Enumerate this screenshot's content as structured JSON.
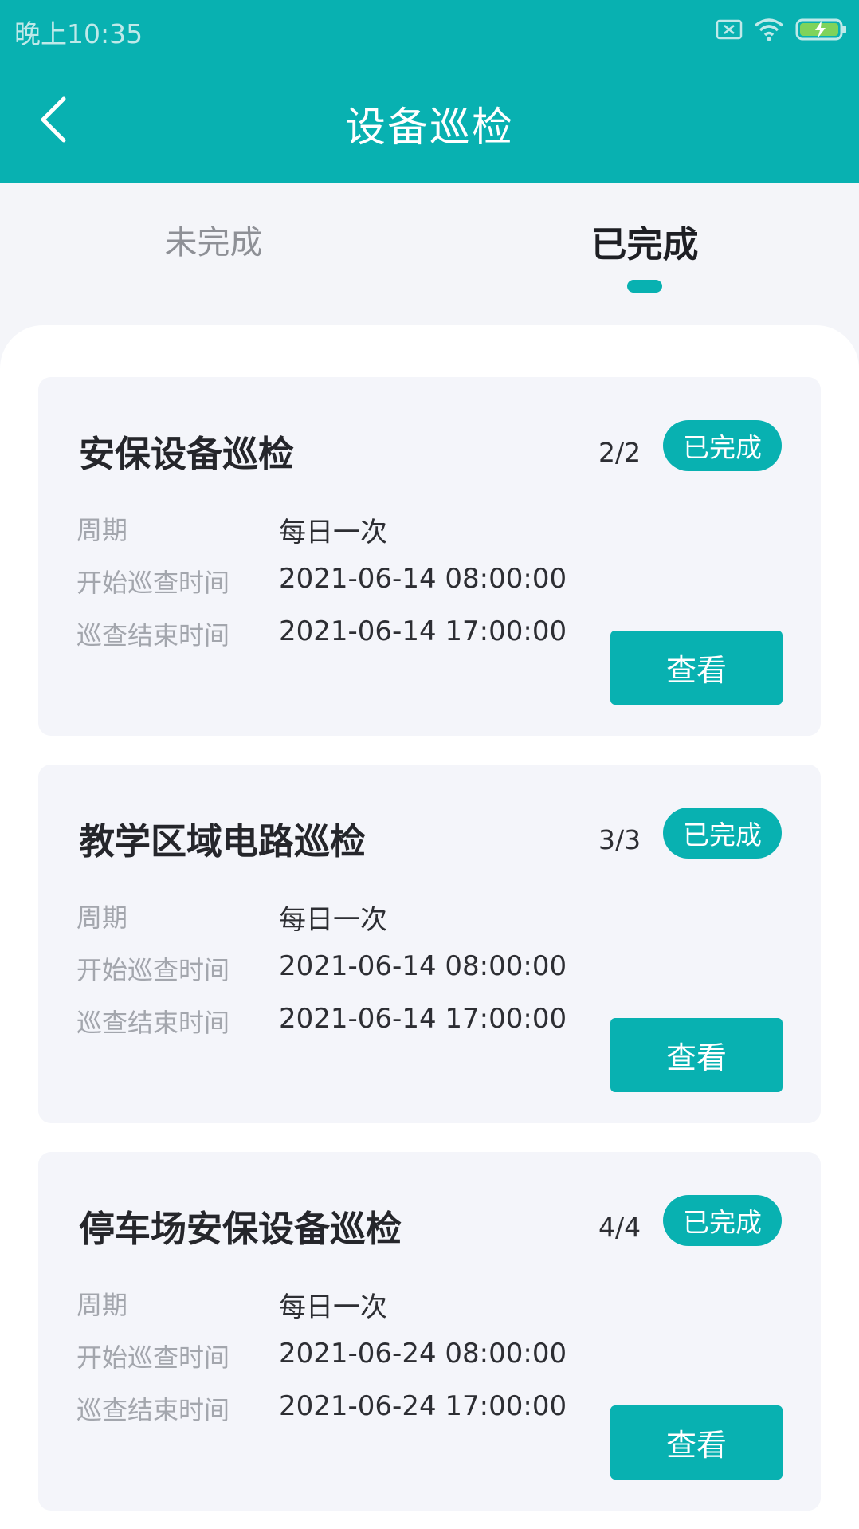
{
  "status_bar": {
    "time": "晚上10:35"
  },
  "header": {
    "title": "设备巡检",
    "back_icon": "back-chevron-icon"
  },
  "tabs": [
    {
      "label": "未完成",
      "active": false
    },
    {
      "label": "已完成",
      "active": true
    }
  ],
  "colors": {
    "accent": "#08b1b1",
    "page_bg": "#f4f5f9",
    "card_bg": "#f4f5fa"
  },
  "cards": [
    {
      "title": "安保设备巡检",
      "count": "2/2",
      "badge": "已完成",
      "rows": [
        {
          "label": "周期",
          "value": "每日一次"
        },
        {
          "label": "开始巡查时间",
          "value": "2021-06-14 08:00:00"
        },
        {
          "label": "巡查结束时间",
          "value": "2021-06-14 17:00:00"
        }
      ],
      "button": "查看"
    },
    {
      "title": "教学区域电路巡检",
      "count": "3/3",
      "badge": "已完成",
      "rows": [
        {
          "label": "周期",
          "value": "每日一次"
        },
        {
          "label": "开始巡查时间",
          "value": "2021-06-14 08:00:00"
        },
        {
          "label": "巡查结束时间",
          "value": "2021-06-14 17:00:00"
        }
      ],
      "button": "查看"
    },
    {
      "title": "停车场安保设备巡检",
      "count": "4/4",
      "badge": "已完成",
      "rows": [
        {
          "label": "周期",
          "value": "每日一次"
        },
        {
          "label": "开始巡查时间",
          "value": "2021-06-24 08:00:00"
        },
        {
          "label": "巡查结束时间",
          "value": "2021-06-24 17:00:00"
        }
      ],
      "button": "查看"
    }
  ]
}
